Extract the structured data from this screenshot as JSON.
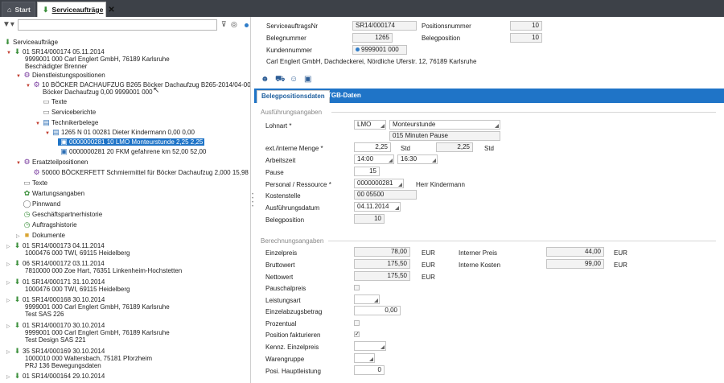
{
  "tabs": [
    {
      "label": "Start"
    },
    {
      "label": "Serviceaufträge"
    }
  ],
  "filter": {
    "placeholder": ""
  },
  "tree": [
    {
      "text": "Serviceaufträge"
    },
    {
      "text": "01 SR14/000174 05.11.2014"
    },
    {
      "text": "9999001 000 Carl Englert GmbH, 76189 Karlsruhe"
    },
    {
      "text": "Beschädigter Brenner"
    },
    {
      "text": "Dienstleistungspositionen"
    },
    {
      "text": "10 BÖCKER DACHAUFZUG B265 Böcker Dachaufzug B265-2014/04-004-67"
    },
    {
      "text": "Böcker Dachaufzug 0,00 9999001 000"
    },
    {
      "text": "Texte"
    },
    {
      "text": "Serviceberichte"
    },
    {
      "text": "Technikerbelege"
    },
    {
      "text": "1265  N  01  00281  Dieter Kindermann    0,00  0,00"
    },
    {
      "text": "0000000281  10  LMO  Monteurstunde  2,25  2,25"
    },
    {
      "text": "0000000281  20  FKM  gefahrene km  52,00  52,00"
    },
    {
      "text": "Ersatzteilpositionen"
    },
    {
      "text": "50000  BÖCKERFETT  Schmiermittel für Böcker Dachaufzug  2,000  15,98"
    },
    {
      "text": "Texte"
    },
    {
      "text": "Wartungsangaben"
    },
    {
      "text": "Pinnwand"
    },
    {
      "text": "Geschäftspartnerhistorie"
    },
    {
      "text": "Auftragshistorie"
    },
    {
      "text": "Dokumente"
    },
    {
      "text": "01 SR14/000173 04.11.2014"
    },
    {
      "text": "1000476 000 TWI, 69115 Heidelberg"
    },
    {
      "text": "06 SR14/000172 03.11.2014"
    },
    {
      "text": "7810000 000 Zoe Hart, 76351 Linkenheim-Hochstetten"
    },
    {
      "text": "01 SR14/000171 31.10.2014"
    },
    {
      "text": "1000476 000 TWI, 69115 Heidelberg"
    },
    {
      "text": "01 SR14/000168 30.10.2014"
    },
    {
      "text": "9999001 000 Carl Englert GmbH, 76189 Karlsruhe"
    },
    {
      "text": "Test SAS 226"
    },
    {
      "text": "01 SR14/000170 30.10.2014"
    },
    {
      "text": "9999001 000 Carl Englert GmbH, 76189 Karlsruhe"
    },
    {
      "text": "Test Design SAS 221"
    },
    {
      "text": "35 SR14/000169 30.10.2014"
    },
    {
      "text": "1000010 000 Waltersbach, 75181 Pforzheim"
    },
    {
      "text": "PRJ 136 Bewegungsdaten"
    },
    {
      "text": "01 SR14/000164 29.10.2014"
    }
  ],
  "header": {
    "auftragsnr_label": "ServiceauftragsNr",
    "auftragsnr_value": "SR14/000174",
    "positionsnummer_label": "Positionsnummer",
    "positionsnummer_value": "10",
    "belegnummer_label": "Belegnummer",
    "belegnummer_value": "1265",
    "belegposition_label": "Belegposition",
    "belegposition_value": "10",
    "kundennummer_label": "Kundennummer",
    "kundennummer_value": "9999001 000",
    "address": "Carl Englert GmbH, Dachdeckerei, Nördliche Uferstr. 12, 76189 Karlsruhe"
  },
  "subtabs": [
    {
      "label": "Belegpositionsdaten"
    },
    {
      "label": "TGB-Daten"
    }
  ],
  "ausfuehrung": {
    "section": "Ausführungsangaben",
    "lohnart_label": "Lohnart *",
    "lohnart_value": "LMO",
    "lohnart_desc": "Monteurstunde",
    "lohnart_desc2": "015 Minuten Pause",
    "menge_label": "ext./interne Menge *",
    "menge_ext": "2,25",
    "menge_ext_unit": "Std",
    "menge_int": "2,25",
    "menge_int_unit": "Std",
    "arbeitszeit_label": "Arbeitszeit",
    "arbeitszeit_from": "14:00",
    "arbeitszeit_to": "16:30",
    "pause_label": "Pause",
    "pause_value": "15",
    "personal_label": "Personal / Ressource *",
    "personal_value": "0000000281",
    "personal_name": "Herr Kindermann",
    "kostenstelle_label": "Kostenstelle",
    "kostenstelle_value": "00 05500",
    "datum_label": "Ausführungsdatum",
    "datum_value": "04.11.2014",
    "belegposition_label": "Belegposition",
    "belegposition_value": "10"
  },
  "berechnung": {
    "section": "Berechnungsangaben",
    "einzelpreis_label": "Einzelpreis",
    "einzelpreis_value": "78,00",
    "einzelpreis_cur": "EUR",
    "interner_preis_label": "Interner Preis",
    "interner_preis_value": "44,00",
    "interner_preis_cur": "EUR",
    "brutto_label": "Bruttowert",
    "brutto_value": "175,50",
    "brutto_cur": "EUR",
    "interne_kosten_label": "Interne Kosten",
    "interne_kosten_value": "99,00",
    "interne_kosten_cur": "EUR",
    "netto_label": "Nettowert",
    "netto_value": "175,50",
    "netto_cur": "EUR",
    "pauschal_label": "Pauschalpreis",
    "leistungsart_label": "Leistungsart",
    "einzelabzug_label": "Einzelabzugsbetrag",
    "einzelabzug_value": "0,00",
    "prozentual_label": "Prozentual",
    "fakturieren_label": "Position fakturieren",
    "fakturieren_check": "✓",
    "kennz_label": "Kennz. Einzelpreis",
    "warengruppe_label": "Warengruppe",
    "hauptleistung_label": "Posi. Hauptleistung",
    "hauptleistung_value": "0"
  }
}
